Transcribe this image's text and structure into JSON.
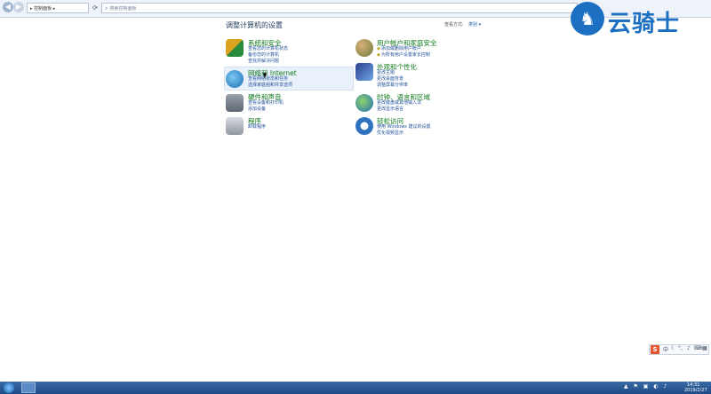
{
  "address_bar": {
    "breadcrumb": "▸ 控制面板 ▸",
    "search_placeholder": "搜索控制面板"
  },
  "watermark": {
    "text": "云骑士"
  },
  "header": {
    "title": "调整计算机的设置",
    "view_by_label": "查看方式:",
    "view_by_value": "类别 ▾"
  },
  "categories": [
    {
      "title": "系统和安全",
      "icon": "shield-computer-icon",
      "links": [
        "查看您的计算机状态",
        "备份您的计算机",
        "查找并解决问题"
      ]
    },
    {
      "title": "网络和 Internet",
      "icon": "network-globe-icon",
      "links": [
        "查看网络状态和任务",
        "选择家庭组和共享选项"
      ]
    },
    {
      "title": "硬件和声音",
      "icon": "printer-speaker-icon",
      "links": [
        "查看设备和打印机",
        "添加设备"
      ]
    },
    {
      "title": "程序",
      "icon": "programs-icon",
      "links": [
        "卸载程序"
      ]
    },
    {
      "title": "用户帐户和家庭安全",
      "icon": "users-icon",
      "links": [
        "添加或删除用户帐户",
        "为所有用户设置家长控制"
      ]
    },
    {
      "title": "外观和个性化",
      "icon": "monitor-appearance-icon",
      "links": [
        "更改主题",
        "更改桌面背景",
        "调整屏幕分辨率"
      ]
    },
    {
      "title": "时钟、语言和区域",
      "icon": "clock-globe-icon",
      "links": [
        "更改键盘或其他输入法",
        "更改显示语言"
      ]
    },
    {
      "title": "轻松访问",
      "icon": "ease-of-access-icon",
      "links": [
        "使用 Windows 建议的设置",
        "优化视频显示"
      ]
    }
  ],
  "taskbar": {
    "time": "14:31",
    "date": "2019/2/27"
  },
  "ime": {
    "logo": "S"
  },
  "colors": {
    "accent_green": "#0e7a18",
    "link_blue": "#1f4f9a",
    "taskbar": "#1d4a86",
    "brand_blue": "#1d6fc2"
  }
}
